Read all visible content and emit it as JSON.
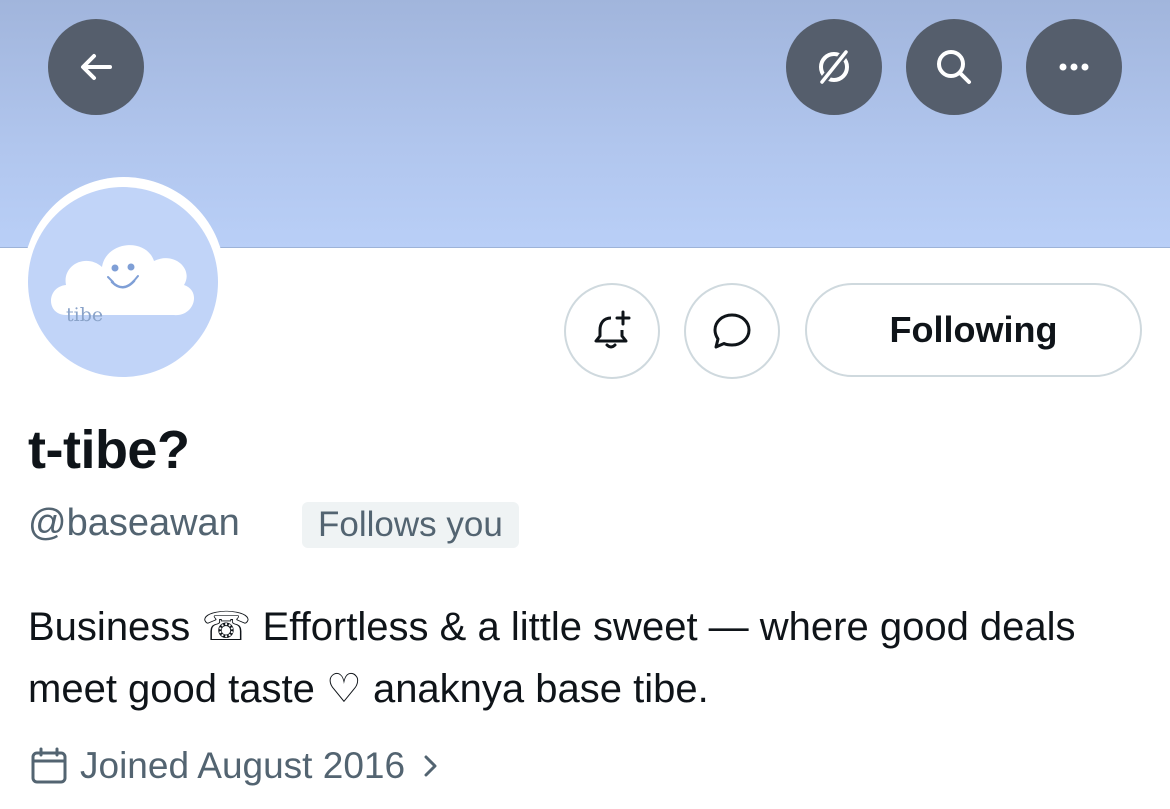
{
  "header": {
    "icons": [
      "arrow-left-icon",
      "grok-icon",
      "search-icon",
      "more-icon"
    ],
    "banner_color": "#b1c6ee",
    "button_color": "#555e6c"
  },
  "avatar": {
    "text": "tibe",
    "bg_color": "#c1d4f8"
  },
  "actions": {
    "following_label": "Following"
  },
  "profile": {
    "display_name": "t-tibe?",
    "handle": "@baseawan",
    "follows_you": "Follows you",
    "bio": "Business ☏ Effortless & a little sweet — where good deals meet good taste ♡ anaknya base tibe.",
    "joined": "Joined August 2016"
  }
}
